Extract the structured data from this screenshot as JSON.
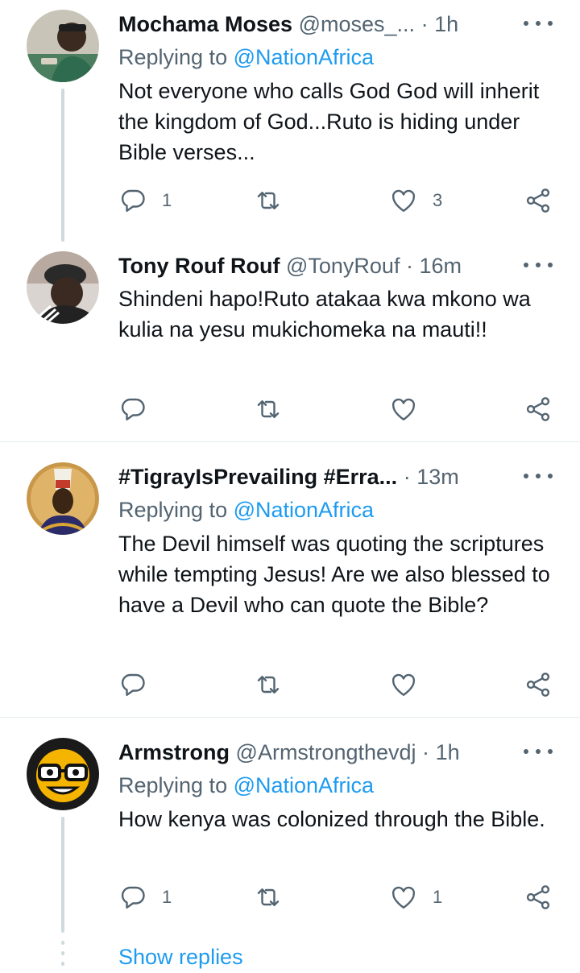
{
  "tweets": [
    {
      "name": "Mochama Moses",
      "handle": "@moses_...",
      "dot": "·",
      "time": "1h",
      "replying_prefix": "Replying to ",
      "replying_to": "@NationAfrica",
      "text": "Not everyone who calls God God will inherit the kingdom of God...Ruto is hiding under Bible verses...",
      "reply_count": "1",
      "retweet_count": "",
      "like_count": "3"
    },
    {
      "name": "Tony Rouf Rouf",
      "handle": "@TonyRouf",
      "dot": "·",
      "time": "16m",
      "text": "Shindeni hapo!Ruto atakaa kwa mkono wa kulia na yesu mukichomeka na mauti!!",
      "reply_count": "",
      "retweet_count": "",
      "like_count": ""
    },
    {
      "name": "#TigrayIsPrevailing #Erra...",
      "handle": "",
      "dot": "·",
      "time": "13m",
      "replying_prefix": "Replying to ",
      "replying_to": "@NationAfrica",
      "text": "The Devil himself was quoting the scriptures while tempting Jesus! Are we also blessed to have a Devil who can quote the Bible?",
      "reply_count": "",
      "retweet_count": "",
      "like_count": ""
    },
    {
      "name": "Armstrong",
      "handle": "@Armstrongthevdj",
      "dot": "·",
      "time": "1h",
      "replying_prefix": "Replying to ",
      "replying_to": "@NationAfrica",
      "text": "How kenya was colonized through the Bible.",
      "reply_count": "1",
      "retweet_count": "",
      "like_count": "1"
    }
  ],
  "show_replies": "Show replies",
  "colors": {
    "link": "#1d9bf0",
    "secondary_text": "#536471",
    "thread_line": "#cfd9de"
  }
}
